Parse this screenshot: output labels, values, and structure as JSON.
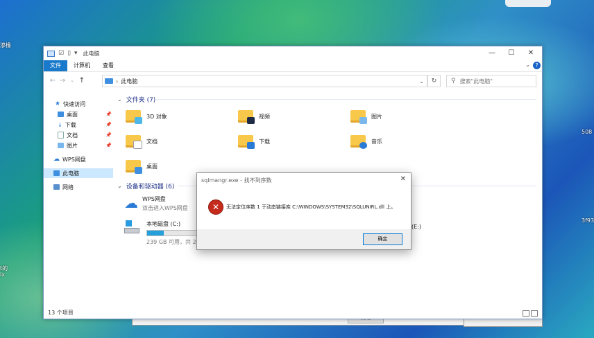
{
  "desktop": {
    "fragments": [
      "渗橡",
      "508",
      "3f93",
      "t的",
      "ix"
    ]
  },
  "background_window": {
    "button_label": "发送"
  },
  "explorer": {
    "title": "此电脑",
    "controls": {
      "minimize": "—",
      "maximize": "☐",
      "close": "✕"
    },
    "ribbon_tabs": [
      "文件",
      "计算机",
      "查看"
    ],
    "help_label": "?",
    "address": {
      "path": "此电脑"
    },
    "search_placeholder": "搜索\"此电脑\"",
    "sidebar": {
      "quick_access": "快速访问",
      "items": [
        "桌面",
        "下载",
        "文档",
        "图片"
      ],
      "wps": "WPS网盘",
      "this_pc": "此电脑",
      "network": "网络"
    },
    "folders_header": "文件夹 (7)",
    "folders": [
      "3D 对象",
      "视频",
      "图片",
      "文档",
      "下载",
      "音乐",
      "桌面"
    ],
    "devices_header": "设备和驱动器 (6)",
    "wps_drive": {
      "name": "WPS网盘",
      "sub": "双击进入WPS网盘"
    },
    "local_drive": {
      "name": "本地磁盘 (C:)",
      "sub": "239 GB 可用，共 29",
      "used": 0.2
    },
    "other_drive_label": "(E:)",
    "status": "13 个项目",
    "colors": {
      "accent": "#1979ca",
      "folder": "#f7c84a",
      "error": "#c42b1c"
    }
  },
  "dialog": {
    "title": "sqlmangr.exe - 找不到序数",
    "close": "✕",
    "message": "无法定位序数 1 于动态链接库 C:\\WINDOWS\\SYSTEM32\\SQLUNIRL.dll 上。",
    "ok_label": "确定"
  }
}
